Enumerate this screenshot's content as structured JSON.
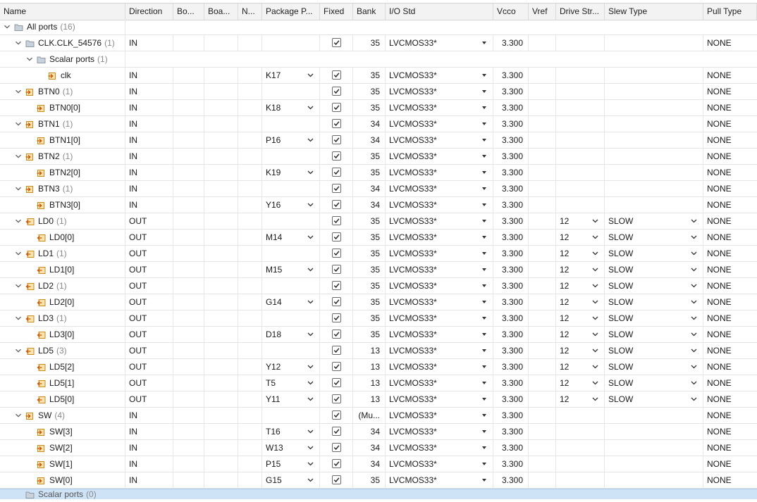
{
  "columns": [
    "Name",
    "Direction",
    "Bo...",
    "Boa...",
    "N...",
    "Package P...",
    "Fixed",
    "Bank",
    "I/O Std",
    "Vcco",
    "Vref",
    "Drive Str...",
    "Slew Type",
    "Pull Type"
  ],
  "rows": [
    {
      "level": 0,
      "expand": true,
      "icon": "folder",
      "name": "All ports",
      "count": "(16)",
      "group": true
    },
    {
      "level": 1,
      "expand": true,
      "icon": "folder",
      "name": "CLK.CLK_54576",
      "count": "(1)",
      "direction": "IN",
      "fixed": true,
      "bank": "35",
      "iostd": "LVCMOS33*",
      "vcco": "3.300",
      "pull": "NONE"
    },
    {
      "level": 2,
      "expand": true,
      "icon": "folder",
      "name": "Scalar ports",
      "count": "(1)",
      "group": true
    },
    {
      "level": 3,
      "expand": false,
      "icon": "in",
      "name": "clk",
      "direction": "IN",
      "pkg": "K17",
      "fixed": true,
      "bank": "35",
      "iostd": "LVCMOS33*",
      "vcco": "3.300",
      "pull": "NONE"
    },
    {
      "level": 1,
      "expand": true,
      "icon": "in",
      "name": "BTN0",
      "count": "(1)",
      "direction": "IN",
      "fixed": true,
      "bank": "35",
      "iostd": "LVCMOS33*",
      "vcco": "3.300",
      "pull": "NONE"
    },
    {
      "level": 2,
      "expand": false,
      "icon": "in",
      "name": "BTN0[0]",
      "direction": "IN",
      "pkg": "K18",
      "fixed": true,
      "bank": "35",
      "iostd": "LVCMOS33*",
      "vcco": "3.300",
      "pull": "NONE"
    },
    {
      "level": 1,
      "expand": true,
      "icon": "in",
      "name": "BTN1",
      "count": "(1)",
      "direction": "IN",
      "fixed": true,
      "bank": "34",
      "iostd": "LVCMOS33*",
      "vcco": "3.300",
      "pull": "NONE"
    },
    {
      "level": 2,
      "expand": false,
      "icon": "in",
      "name": "BTN1[0]",
      "direction": "IN",
      "pkg": "P16",
      "fixed": true,
      "bank": "34",
      "iostd": "LVCMOS33*",
      "vcco": "3.300",
      "pull": "NONE"
    },
    {
      "level": 1,
      "expand": true,
      "icon": "in",
      "name": "BTN2",
      "count": "(1)",
      "direction": "IN",
      "fixed": true,
      "bank": "35",
      "iostd": "LVCMOS33*",
      "vcco": "3.300",
      "pull": "NONE"
    },
    {
      "level": 2,
      "expand": false,
      "icon": "in",
      "name": "BTN2[0]",
      "direction": "IN",
      "pkg": "K19",
      "fixed": true,
      "bank": "35",
      "iostd": "LVCMOS33*",
      "vcco": "3.300",
      "pull": "NONE"
    },
    {
      "level": 1,
      "expand": true,
      "icon": "in",
      "name": "BTN3",
      "count": "(1)",
      "direction": "IN",
      "fixed": true,
      "bank": "34",
      "iostd": "LVCMOS33*",
      "vcco": "3.300",
      "pull": "NONE"
    },
    {
      "level": 2,
      "expand": false,
      "icon": "in",
      "name": "BTN3[0]",
      "direction": "IN",
      "pkg": "Y16",
      "fixed": true,
      "bank": "34",
      "iostd": "LVCMOS33*",
      "vcco": "3.300",
      "pull": "NONE"
    },
    {
      "level": 1,
      "expand": true,
      "icon": "out",
      "name": "LD0",
      "count": "(1)",
      "direction": "OUT",
      "fixed": true,
      "bank": "35",
      "iostd": "LVCMOS33*",
      "vcco": "3.300",
      "drive": "12",
      "slew": "SLOW",
      "pull": "NONE"
    },
    {
      "level": 2,
      "expand": false,
      "icon": "out",
      "name": "LD0[0]",
      "direction": "OUT",
      "pkg": "M14",
      "fixed": true,
      "bank": "35",
      "iostd": "LVCMOS33*",
      "vcco": "3.300",
      "drive": "12",
      "slew": "SLOW",
      "pull": "NONE"
    },
    {
      "level": 1,
      "expand": true,
      "icon": "out",
      "name": "LD1",
      "count": "(1)",
      "direction": "OUT",
      "fixed": true,
      "bank": "35",
      "iostd": "LVCMOS33*",
      "vcco": "3.300",
      "drive": "12",
      "slew": "SLOW",
      "pull": "NONE"
    },
    {
      "level": 2,
      "expand": false,
      "icon": "out",
      "name": "LD1[0]",
      "direction": "OUT",
      "pkg": "M15",
      "fixed": true,
      "bank": "35",
      "iostd": "LVCMOS33*",
      "vcco": "3.300",
      "drive": "12",
      "slew": "SLOW",
      "pull": "NONE"
    },
    {
      "level": 1,
      "expand": true,
      "icon": "out",
      "name": "LD2",
      "count": "(1)",
      "direction": "OUT",
      "fixed": true,
      "bank": "35",
      "iostd": "LVCMOS33*",
      "vcco": "3.300",
      "drive": "12",
      "slew": "SLOW",
      "pull": "NONE"
    },
    {
      "level": 2,
      "expand": false,
      "icon": "out",
      "name": "LD2[0]",
      "direction": "OUT",
      "pkg": "G14",
      "fixed": true,
      "bank": "35",
      "iostd": "LVCMOS33*",
      "vcco": "3.300",
      "drive": "12",
      "slew": "SLOW",
      "pull": "NONE"
    },
    {
      "level": 1,
      "expand": true,
      "icon": "out",
      "name": "LD3",
      "count": "(1)",
      "direction": "OUT",
      "fixed": true,
      "bank": "35",
      "iostd": "LVCMOS33*",
      "vcco": "3.300",
      "drive": "12",
      "slew": "SLOW",
      "pull": "NONE"
    },
    {
      "level": 2,
      "expand": false,
      "icon": "out",
      "name": "LD3[0]",
      "direction": "OUT",
      "pkg": "D18",
      "fixed": true,
      "bank": "35",
      "iostd": "LVCMOS33*",
      "vcco": "3.300",
      "drive": "12",
      "slew": "SLOW",
      "pull": "NONE"
    },
    {
      "level": 1,
      "expand": true,
      "icon": "out",
      "name": "LD5",
      "count": "(3)",
      "direction": "OUT",
      "fixed": true,
      "bank": "13",
      "iostd": "LVCMOS33*",
      "vcco": "3.300",
      "drive": "12",
      "slew": "SLOW",
      "pull": "NONE"
    },
    {
      "level": 2,
      "expand": false,
      "icon": "out",
      "name": "LD5[2]",
      "direction": "OUT",
      "pkg": "Y12",
      "fixed": true,
      "bank": "13",
      "iostd": "LVCMOS33*",
      "vcco": "3.300",
      "drive": "12",
      "slew": "SLOW",
      "pull": "NONE"
    },
    {
      "level": 2,
      "expand": false,
      "icon": "out",
      "name": "LD5[1]",
      "direction": "OUT",
      "pkg": "T5",
      "fixed": true,
      "bank": "13",
      "iostd": "LVCMOS33*",
      "vcco": "3.300",
      "drive": "12",
      "slew": "SLOW",
      "pull": "NONE"
    },
    {
      "level": 2,
      "expand": false,
      "icon": "out",
      "name": "LD5[0]",
      "direction": "OUT",
      "pkg": "Y11",
      "fixed": true,
      "bank": "13",
      "iostd": "LVCMOS33*",
      "vcco": "3.300",
      "drive": "12",
      "slew": "SLOW",
      "pull": "NONE"
    },
    {
      "level": 1,
      "expand": true,
      "icon": "in",
      "name": "SW",
      "count": "(4)",
      "direction": "IN",
      "fixed": true,
      "bank": "(Mu...",
      "iostd": "LVCMOS33*",
      "vcco": "3.300",
      "pull": "NONE"
    },
    {
      "level": 2,
      "expand": false,
      "icon": "in",
      "name": "SW[3]",
      "direction": "IN",
      "pkg": "T16",
      "fixed": true,
      "bank": "34",
      "iostd": "LVCMOS33*",
      "vcco": "3.300",
      "pull": "NONE"
    },
    {
      "level": 2,
      "expand": false,
      "icon": "in",
      "name": "SW[2]",
      "direction": "IN",
      "pkg": "W13",
      "fixed": true,
      "bank": "34",
      "iostd": "LVCMOS33*",
      "vcco": "3.300",
      "pull": "NONE"
    },
    {
      "level": 2,
      "expand": false,
      "icon": "in",
      "name": "SW[1]",
      "direction": "IN",
      "pkg": "P15",
      "fixed": true,
      "bank": "34",
      "iostd": "LVCMOS33*",
      "vcco": "3.300",
      "pull": "NONE"
    },
    {
      "level": 2,
      "expand": false,
      "icon": "in",
      "name": "SW[0]",
      "direction": "IN",
      "pkg": "G15",
      "fixed": true,
      "bank": "35",
      "iostd": "LVCMOS33*",
      "vcco": "3.300",
      "pull": "NONE"
    }
  ],
  "footer_row": {
    "name": "Scalar ports",
    "count": "(0)"
  },
  "colors": {
    "accent_selection": "#cfe3f7",
    "icon_orange": "#e1a23a",
    "folder_gray": "#9aa5b1"
  }
}
